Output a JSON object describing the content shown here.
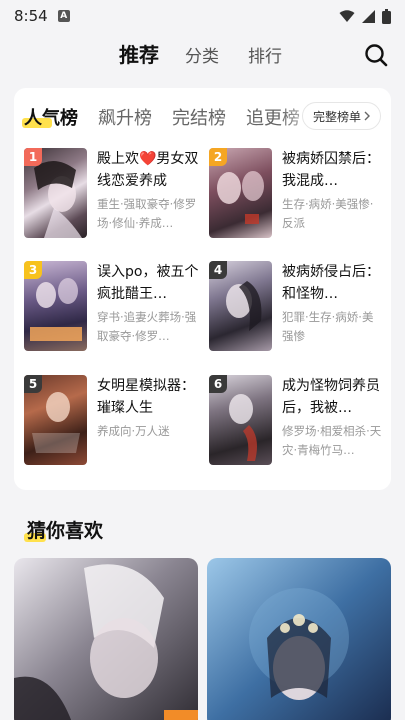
{
  "status": {
    "time": "8:54",
    "notif_glyph": "A"
  },
  "nav": {
    "tabs": [
      "推荐",
      "分类",
      "排行"
    ]
  },
  "ranking": {
    "tabs": [
      "人气榜",
      "飙升榜",
      "完结榜",
      "追更榜"
    ],
    "full_list": "完整榜单",
    "books": [
      {
        "rank": "1",
        "title": "殿上欢❤️男女双线恋爱养成",
        "tags": "重生·强取豪夺·修罗场·修仙·养成…"
      },
      {
        "rank": "2",
        "title": "被病娇囚禁后：我混成…",
        "tags": "生存·病娇·美强惨·反派"
      },
      {
        "rank": "3",
        "title": "误入po，被五个疯批醋王…",
        "tags": "穿书·追妻火葬场·强取豪夺·修罗…"
      },
      {
        "rank": "4",
        "title": "被病娇侵占后：和怪物…",
        "tags": "犯罪·生存·病娇·美强惨"
      },
      {
        "rank": "5",
        "title": "女明星模拟器：璀璨人生",
        "tags": "养成向·万人迷"
      },
      {
        "rank": "6",
        "title": "成为怪物饲养员后，我被…",
        "tags": "修罗场·相爱相杀·天灾·青梅竹马…"
      }
    ]
  },
  "guess": {
    "title": "猜你喜欢"
  },
  "colors": {
    "accent": "#ffe14d",
    "rank1": "#f26a5a",
    "rank2": "#f5a623",
    "rank3": "#f7c21e",
    "rank_other": "#3a3a3a"
  }
}
